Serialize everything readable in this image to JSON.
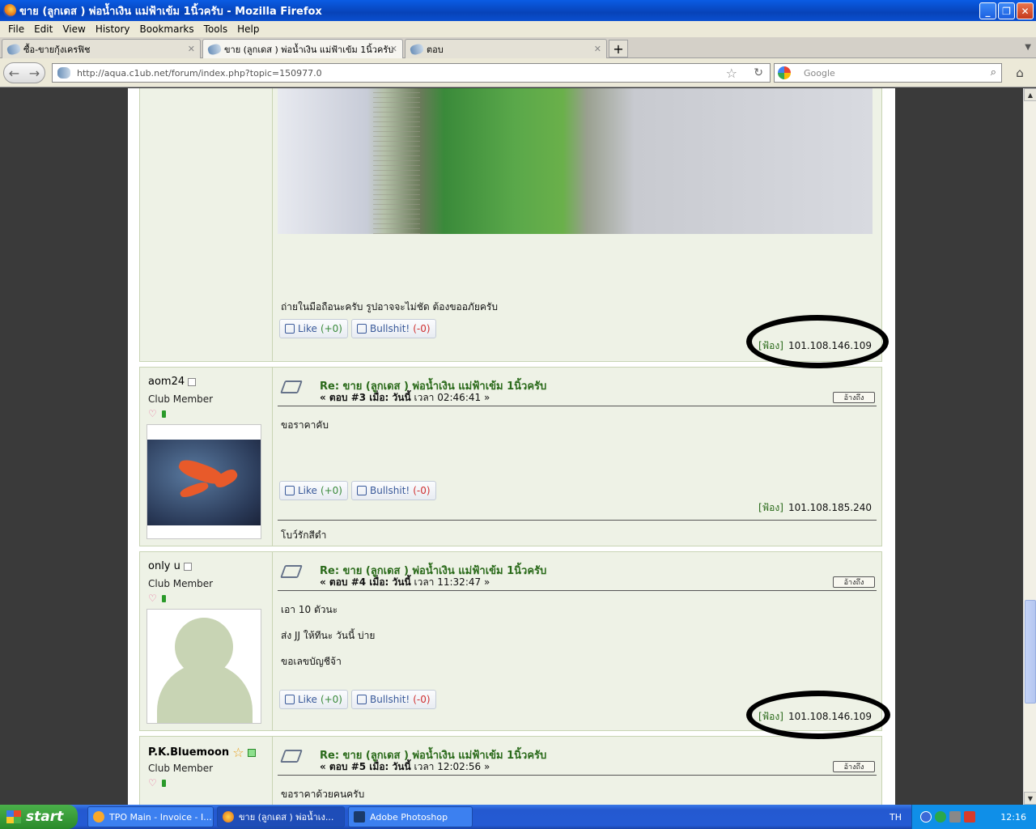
{
  "window": {
    "title": "ขาย (ลูกเดส ) พ่อน้ำเงิน แม่ฟ้าเข้ม 1นิ้วครับ - Mozilla Firefox"
  },
  "menu": [
    "File",
    "Edit",
    "View",
    "History",
    "Bookmarks",
    "Tools",
    "Help"
  ],
  "tabs": [
    {
      "label": "ซื้อ-ขายกุ้งเครฟิช"
    },
    {
      "label": "ขาย (ลูกเดส ) พ่อน้ำเงิน แม่ฟ้าเข้ม 1นิ้วครับ"
    },
    {
      "label": "ตอบ"
    }
  ],
  "url": "http://aqua.c1ub.net/forum/index.php?topic=150977.0",
  "search": {
    "placeholder": "Google"
  },
  "likes": {
    "like": "Like",
    "like_count": "(+0)",
    "bs": "Bullshit!",
    "bs_count": "(-0)"
  },
  "ip_tag": "[ฟ้อง]",
  "quote_label": "อ้างถึง",
  "posts": [
    {
      "body": "ถ่ายในมือถือนะครับ  รูปอาจจะไม่ชัด   ต้องขออภัยครับ",
      "ip": "101.108.146.109"
    },
    {
      "user": "aom24",
      "rank": "Club Member",
      "title": "Re: ขาย (ลูกเดส ) พ่อน้ำเงิน แม่ฟ้าเข้ม 1นิ้วครับ",
      "meta_prefix": "« ตอบ #3 เมื่อ: วันนี้",
      "meta_time": "เวลา 02:46:41 »",
      "body": "ขอราคาคับ",
      "ip": "101.108.185.240",
      "sig": "โบว์รักสีดำ"
    },
    {
      "user": "only u",
      "rank": "Club Member",
      "title": "Re: ขาย (ลูกเดส ) พ่อน้ำเงิน แม่ฟ้าเข้ม 1นิ้วครับ",
      "meta_prefix": "« ตอบ #4 เมื่อ: วันนี้",
      "meta_time": "เวลา 11:32:47 »",
      "body1": "เอา  10  ตัวนะ",
      "body2": "ส่ง  JJ ให้ทีนะ   วันนี้  บ่าย",
      "body3": "ขอเลขบัญชีจ้า",
      "ip": "101.108.146.109"
    },
    {
      "user": "P.K.Bluemoon",
      "rank": "Club Member",
      "title": "Re: ขาย (ลูกเดส ) พ่อน้ำเงิน แม่ฟ้าเข้ม 1นิ้วครับ",
      "meta_prefix": "« ตอบ #5 เมื่อ: วันนี้",
      "meta_time": "เวลา 12:02:56 »",
      "body": "ขอราคาด้วยคนครับ"
    }
  ],
  "taskbar": {
    "start": "start",
    "tasks": [
      "TPO Main - Invoice - I...",
      "ขาย (ลูกเดส ) พ่อน้ำเง...",
      "Adobe Photoshop"
    ],
    "lang": "TH",
    "clock": "12:16"
  }
}
